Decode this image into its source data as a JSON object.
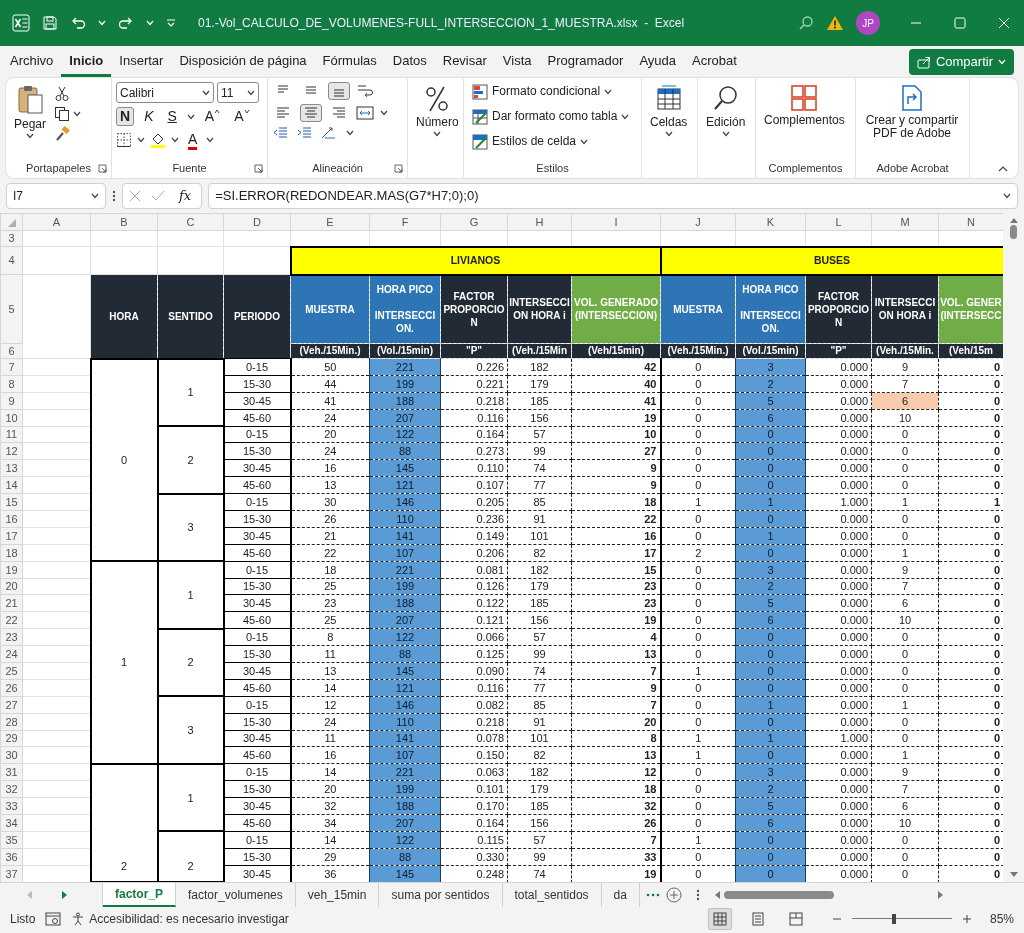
{
  "title_bar": {
    "title": "01.-Vol_CALCULO_DE_VOLUMENES-FULL_INTERSECCION_1_MUESTRA.xlsx  -  Excel",
    "user_initials": "JP"
  },
  "menu_tabs": [
    {
      "label": "Archivo",
      "selected": false
    },
    {
      "label": "Inicio",
      "selected": true
    },
    {
      "label": "Insertar",
      "selected": false
    },
    {
      "label": "Disposición de página",
      "selected": false
    },
    {
      "label": "Fórmulas",
      "selected": false
    },
    {
      "label": "Datos",
      "selected": false
    },
    {
      "label": "Revisar",
      "selected": false
    },
    {
      "label": "Vista",
      "selected": false
    },
    {
      "label": "Programador",
      "selected": false
    },
    {
      "label": "Ayuda",
      "selected": false
    },
    {
      "label": "Acrobat",
      "selected": false
    }
  ],
  "share_button": {
    "label": "Compartir"
  },
  "ribbon": {
    "clipboard": {
      "paste_label": "Pegar",
      "group_label": "Portapapeles"
    },
    "font": {
      "font_name": "Calibri",
      "font_size": "11",
      "style_buttons": [
        {
          "label": "N",
          "kind": "bold",
          "selected": true
        },
        {
          "label": "K",
          "kind": "italic",
          "selected": false
        },
        {
          "label": "S",
          "kind": "underline",
          "selected": false
        }
      ],
      "size_buttons": [
        {
          "label": "A",
          "kind": "grow"
        },
        {
          "label": "A",
          "kind": "shrink"
        }
      ],
      "font_color_label": "A",
      "group_label": "Fuente"
    },
    "alignment": {
      "vertical": [
        {
          "kind": "top",
          "selected": false
        },
        {
          "kind": "middle",
          "selected": false
        },
        {
          "kind": "bottom",
          "selected": true
        }
      ],
      "horizontal": [
        {
          "kind": "left",
          "selected": false
        },
        {
          "kind": "center",
          "selected": true
        },
        {
          "kind": "right",
          "selected": false
        }
      ],
      "group_label": "Alineación"
    },
    "number": {
      "label": "Número"
    },
    "styles": {
      "buttons": [
        {
          "label": "Formato condicional",
          "kind": "conditional"
        },
        {
          "label": "Dar formato como tabla",
          "kind": "table"
        },
        {
          "label": "Estilos de celda",
          "kind": "cell"
        }
      ],
      "group_label": "Estilos"
    },
    "cells": {
      "label": "Celdas"
    },
    "editing": {
      "label": "Edición"
    },
    "addins": {
      "label": "Complementos",
      "group_label": "Complementos"
    },
    "adobe": {
      "label": "Crear y compartir PDF de Adobe",
      "group_label": "Adobe Acrobat"
    }
  },
  "formula_bar": {
    "name_box": "I7",
    "fx_label": "fx",
    "formula": "=SI.ERROR(REDONDEAR.MAS(G7*H7;0);0)"
  },
  "sheet": {
    "column_letters": [
      "A",
      "B",
      "C",
      "D",
      "E",
      "F",
      "G",
      "H",
      "I",
      "J",
      "K",
      "L",
      "M",
      "N"
    ],
    "header_row_numbers": [
      "3",
      "4",
      "5",
      "6"
    ],
    "vehicle_groups": [
      {
        "label": "LIVIANOS"
      },
      {
        "label": "BUSES"
      }
    ],
    "key_headers": [
      "HORA",
      "SENTIDO",
      "PERIODO"
    ],
    "measure_headers": [
      {
        "text": "MUESTRA",
        "kind": "sample"
      },
      {
        "text": "HORA PICO\n\nINTERSECCION.",
        "kind": "peak"
      },
      {
        "text": "FACTOR PROPORCION",
        "kind": "factor"
      },
      {
        "text": "INTERSECCION HORA i",
        "kind": "intersection"
      },
      {
        "text": "VOL. GENERADO (INTERSECCION)",
        "kind": "generated"
      },
      {
        "text": "MUESTRA",
        "kind": "sample"
      },
      {
        "text": "HORA PICO\n\nINTERSECCION.",
        "kind": "peak"
      },
      {
        "text": "FACTOR PROPORCION",
        "kind": "factor"
      },
      {
        "text": "INTERSECCION HORA i",
        "kind": "intersection"
      },
      {
        "text": "VOL. GENER (INTERSECC",
        "kind": "generated"
      }
    ],
    "units": [
      "(Veh./15Min.)",
      "(Vol./15min)",
      "\"P\"",
      "(Veh./15Min",
      "(Veh/15min)",
      "(Veh./15Min.)",
      "(Vol./15min)",
      "\"P\"",
      "(Veh./15Min.",
      "(Veh/15m"
    ],
    "hours": [
      {
        "label": "0",
        "directions": [
          {
            "label": "1",
            "rows": [
              {
                "row": "7",
                "period": "0-15",
                "values": [
                  "50",
                  "221",
                  "0.226",
                  "182",
                  "42",
                  "0",
                  "3",
                  "0.000",
                  "9",
                  "0"
                ]
              },
              {
                "row": "8",
                "period": "15-30",
                "values": [
                  "44",
                  "199",
                  "0.221",
                  "179",
                  "40",
                  "0",
                  "2",
                  "0.000",
                  "7",
                  "0"
                ]
              },
              {
                "row": "9",
                "period": "30-45",
                "values": [
                  "41",
                  "188",
                  "0.218",
                  "185",
                  "41",
                  "0",
                  "5",
                  "0.000",
                  {
                    "text": "6",
                    "highlighted": true
                  },
                  "0"
                ]
              },
              {
                "row": "10",
                "period": "45-60",
                "values": [
                  "24",
                  "207",
                  "0.116",
                  "156",
                  "19",
                  "0",
                  "6",
                  "0.000",
                  "10",
                  "0"
                ]
              }
            ]
          },
          {
            "label": "2",
            "rows": [
              {
                "row": "11",
                "period": "0-15",
                "values": [
                  "20",
                  "122",
                  "0.164",
                  "57",
                  "10",
                  "0",
                  "0",
                  "0.000",
                  "0",
                  "0"
                ]
              },
              {
                "row": "12",
                "period": "15-30",
                "values": [
                  "24",
                  "88",
                  "0.273",
                  "99",
                  "27",
                  "0",
                  "0",
                  "0.000",
                  "0",
                  "0"
                ]
              },
              {
                "row": "13",
                "period": "30-45",
                "values": [
                  "16",
                  "145",
                  "0.110",
                  "74",
                  "9",
                  "0",
                  "0",
                  "0.000",
                  "0",
                  "0"
                ]
              },
              {
                "row": "14",
                "period": "45-60",
                "values": [
                  "13",
                  "121",
                  "0.107",
                  "77",
                  "9",
                  "0",
                  "0",
                  "0.000",
                  "0",
                  "0"
                ]
              }
            ]
          },
          {
            "label": "3",
            "rows": [
              {
                "row": "15",
                "period": "0-15",
                "values": [
                  "30",
                  "146",
                  "0.205",
                  "85",
                  "18",
                  "1",
                  "1",
                  "1.000",
                  "1",
                  "1"
                ]
              },
              {
                "row": "16",
                "period": "15-30",
                "values": [
                  "26",
                  "110",
                  "0.236",
                  "91",
                  "22",
                  "0",
                  "0",
                  "0.000",
                  "0",
                  "0"
                ]
              },
              {
                "row": "17",
                "period": "30-45",
                "values": [
                  "21",
                  "141",
                  "0.149",
                  "101",
                  "16",
                  "0",
                  "1",
                  "0.000",
                  "0",
                  "0"
                ]
              },
              {
                "row": "18",
                "period": "45-60",
                "values": [
                  "22",
                  "107",
                  "0.206",
                  "82",
                  "17",
                  "2",
                  "0",
                  "0.000",
                  "1",
                  "0"
                ]
              }
            ]
          }
        ]
      },
      {
        "label": "1",
        "directions": [
          {
            "label": "1",
            "rows": [
              {
                "row": "19",
                "period": "0-15",
                "values": [
                  "18",
                  "221",
                  "0.081",
                  "182",
                  "15",
                  "0",
                  "3",
                  "0.000",
                  "9",
                  "0"
                ]
              },
              {
                "row": "20",
                "period": "15-30",
                "values": [
                  "25",
                  "199",
                  "0.126",
                  "179",
                  "23",
                  "0",
                  "2",
                  "0.000",
                  "7",
                  "0"
                ]
              },
              {
                "row": "21",
                "period": "30-45",
                "values": [
                  "23",
                  "188",
                  "0.122",
                  "185",
                  "23",
                  "0",
                  "5",
                  "0.000",
                  "6",
                  "0"
                ]
              },
              {
                "row": "22",
                "period": "45-60",
                "values": [
                  "25",
                  "207",
                  "0.121",
                  "156",
                  "19",
                  "0",
                  "6",
                  "0.000",
                  "10",
                  "0"
                ]
              }
            ]
          },
          {
            "label": "2",
            "rows": [
              {
                "row": "23",
                "period": "0-15",
                "values": [
                  "8",
                  "122",
                  "0.066",
                  "57",
                  "4",
                  "0",
                  "0",
                  "0.000",
                  "0",
                  "0"
                ]
              },
              {
                "row": "24",
                "period": "15-30",
                "values": [
                  "11",
                  "88",
                  "0.125",
                  "99",
                  "13",
                  "0",
                  "0",
                  "0.000",
                  "0",
                  "0"
                ]
              },
              {
                "row": "25",
                "period": "30-45",
                "values": [
                  "13",
                  "145",
                  "0.090",
                  "74",
                  "7",
                  "1",
                  "0",
                  "0.000",
                  "0",
                  "0"
                ]
              },
              {
                "row": "26",
                "period": "45-60",
                "values": [
                  "14",
                  "121",
                  "0.116",
                  "77",
                  "9",
                  "0",
                  "0",
                  "0.000",
                  "0",
                  "0"
                ]
              }
            ]
          },
          {
            "label": "3",
            "rows": [
              {
                "row": "27",
                "period": "0-15",
                "values": [
                  "12",
                  "146",
                  "0.082",
                  "85",
                  "7",
                  "0",
                  "1",
                  "0.000",
                  "1",
                  "0"
                ]
              },
              {
                "row": "28",
                "period": "15-30",
                "values": [
                  "24",
                  "110",
                  "0.218",
                  "91",
                  "20",
                  "0",
                  "0",
                  "0.000",
                  "0",
                  "0"
                ]
              },
              {
                "row": "29",
                "period": "30-45",
                "values": [
                  "11",
                  "141",
                  "0.078",
                  "101",
                  "8",
                  "1",
                  "1",
                  "1.000",
                  "0",
                  "0"
                ]
              },
              {
                "row": "30",
                "period": "45-60",
                "values": [
                  "16",
                  "107",
                  "0.150",
                  "82",
                  "13",
                  "1",
                  "0",
                  "0.000",
                  "1",
                  "0"
                ]
              }
            ]
          }
        ]
      },
      {
        "label": "2",
        "directions": [
          {
            "label": "1",
            "rows": [
              {
                "row": "31",
                "period": "0-15",
                "values": [
                  "14",
                  "221",
                  "0.063",
                  "182",
                  "12",
                  "0",
                  "3",
                  "0.000",
                  "9",
                  "0"
                ]
              },
              {
                "row": "32",
                "period": "15-30",
                "values": [
                  "20",
                  "199",
                  "0.101",
                  "179",
                  "18",
                  "0",
                  "2",
                  "0.000",
                  "7",
                  "0"
                ]
              },
              {
                "row": "33",
                "period": "30-45",
                "values": [
                  "32",
                  "188",
                  "0.170",
                  "185",
                  "32",
                  "0",
                  "5",
                  "0.000",
                  "6",
                  "0"
                ]
              },
              {
                "row": "34",
                "period": "45-60",
                "values": [
                  "34",
                  "207",
                  "0.164",
                  "156",
                  "26",
                  "0",
                  "6",
                  "0.000",
                  "10",
                  "0"
                ]
              }
            ]
          },
          {
            "label": "2",
            "rows": [
              {
                "row": "35",
                "period": "0-15",
                "values": [
                  "14",
                  "122",
                  "0.115",
                  "57",
                  "7",
                  "1",
                  "0",
                  "0.000",
                  "0",
                  "0"
                ]
              },
              {
                "row": "36",
                "period": "15-30",
                "values": [
                  "29",
                  "88",
                  "0.330",
                  "99",
                  "33",
                  "0",
                  "0",
                  "0.000",
                  "0",
                  "0"
                ]
              },
              {
                "row": "37",
                "period": "30-45",
                "values": [
                  "36",
                  "145",
                  "0.248",
                  "74",
                  "19",
                  "0",
                  "0",
                  "0.000",
                  "0",
                  "0"
                ]
              }
            ]
          }
        ]
      }
    ]
  },
  "sheet_tabs": [
    {
      "label": "factor_P",
      "selected": true
    },
    {
      "label": "factor_volumenes",
      "selected": false
    },
    {
      "label": "veh_15min",
      "selected": false
    },
    {
      "label": "suma por sentidos",
      "selected": false
    },
    {
      "label": "total_sentidos",
      "selected": false
    },
    {
      "label": "da",
      "selected": false
    }
  ],
  "status_bar": {
    "ready": "Listo",
    "accessibility": "Accesibilidad: es necesario investigar",
    "views": [
      {
        "kind": "normal",
        "selected": true
      },
      {
        "kind": "page_layout",
        "selected": false
      },
      {
        "kind": "page_break",
        "selected": false
      }
    ],
    "zoom": {
      "level": 0.42,
      "reading": "85%"
    }
  }
}
